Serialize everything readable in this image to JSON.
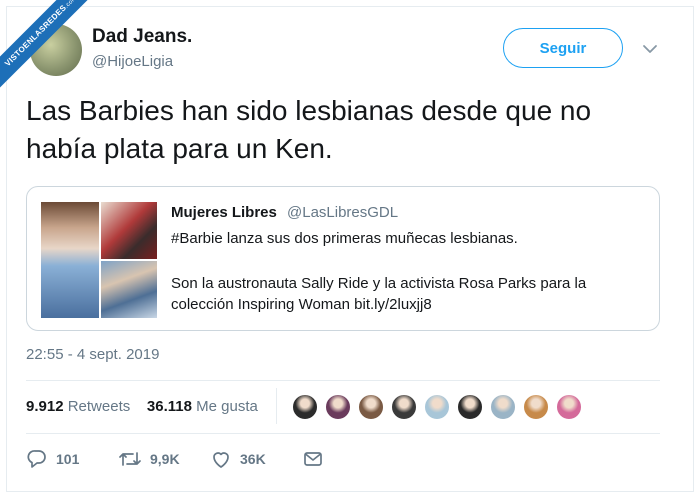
{
  "watermark": {
    "text": "VISTOENLASREDES",
    "sub": ".com"
  },
  "author": {
    "name": "Dad Jeans.",
    "handle": "@HijoeLigia"
  },
  "follow_label": "Seguir",
  "tweet": {
    "line1": "Las Barbies han sido lesbianas desde que no",
    "line2": "había plata para un Ken."
  },
  "quote": {
    "name": "Mujeres Libres",
    "handle": "@LasLibresGDL",
    "line1": "#Barbie lanza sus dos primeras muñecas lesbianas.",
    "line2": "Son la austronauta Sally Ride y la activista Rosa Parks para la",
    "line3": "colección Inspiring Woman bit.ly/2luxjj8"
  },
  "timestamp": "22:55 - 4 sept. 2019",
  "stats": {
    "retweets_count": "9.912",
    "retweets_label": "Retweets",
    "likes_count": "36.118",
    "likes_label": "Me gusta"
  },
  "likers": [
    "#2b2b2b",
    "#6a3b5c",
    "#7a5a44",
    "#3a3a3a",
    "#a8c6d8",
    "#2a2a2a",
    "#9ab4c6",
    "#c78a4a",
    "#d46a9a"
  ],
  "actions": {
    "replies": "101",
    "retweets": "9,9K",
    "likes": "36K"
  },
  "colors": {
    "accent": "#1da1f2",
    "muted": "#657786",
    "text": "#14171a",
    "border": "#e6ecf0"
  },
  "icons": [
    "chevron-down-icon",
    "reply-icon",
    "retweet-icon",
    "heart-icon",
    "message-icon"
  ]
}
